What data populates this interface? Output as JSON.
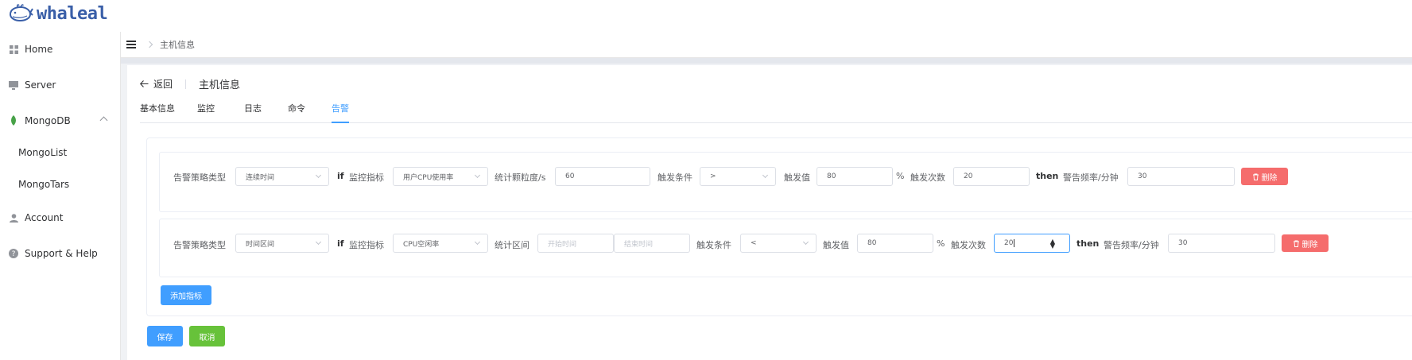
{
  "app": {
    "logo_text": "whaleal"
  },
  "sidebar": {
    "items": [
      {
        "label": "Home",
        "icon": "grid-icon"
      },
      {
        "label": "Server",
        "icon": "monitor-icon"
      },
      {
        "label": "MongoDB",
        "icon": "leaf-icon"
      },
      {
        "label": "MongoList"
      },
      {
        "label": "MongoTars"
      },
      {
        "label": "Account",
        "icon": "user-icon"
      },
      {
        "label": "Support & Help",
        "icon": "help-icon"
      }
    ]
  },
  "header": {
    "breadcrumb": "主机信息"
  },
  "page": {
    "back_label": "返回",
    "title": "主机信息"
  },
  "tabs": [
    "基本信息",
    "监控",
    "日志",
    "命令",
    "告警"
  ],
  "active_tab": "告警",
  "rules": [
    {
      "type_label": "告警策略类型",
      "type_value": "连续时间",
      "if_kw": "if",
      "metric_label": "监控指标",
      "metric_value": "用户CPU使用率",
      "stat_label": "统计颗粒度/s",
      "stat_value": "60",
      "cond_label": "触发条件",
      "cond_value": ">",
      "threshold_label": "触发值",
      "threshold_value": "80",
      "unit": "%",
      "count_label": "触发次数",
      "count_value": "20",
      "then_kw": "then",
      "freq_label": "警告频率/分钟",
      "freq_value": "30",
      "delete_label": "删除"
    },
    {
      "type_label": "告警策略类型",
      "type_value": "时间区间",
      "if_kw": "if",
      "metric_label": "监控指标",
      "metric_value": "CPU空闲率",
      "range_label": "统计区间",
      "start_placeholder": "开始时间",
      "end_placeholder": "结束时间",
      "cond_label": "触发条件",
      "cond_value": "<",
      "threshold_label": "触发值",
      "threshold_value": "80",
      "unit": "%",
      "count_label": "触发次数",
      "count_value": "20",
      "then_kw": "then",
      "freq_label": "警告频率/分钟",
      "freq_value": "30",
      "delete_label": "删除"
    }
  ],
  "actions": {
    "add_metric": "添加指标",
    "save": "保存",
    "cancel": "取消"
  },
  "colors": {
    "primary": "#409eff",
    "danger": "#f56c6c",
    "success": "#67c23a",
    "brand": "#3a5fa8",
    "mongo_leaf": "#47a248"
  }
}
